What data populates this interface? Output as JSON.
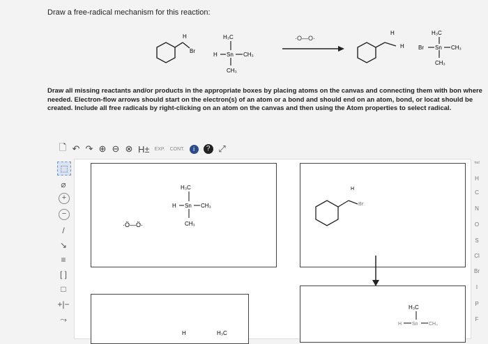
{
  "prompt": "Draw a free-radical mechanism for this reaction:",
  "instructions": "Draw all missing reactants and/or products in the appropriate boxes by placing atoms on the canvas and connecting them with bon where needed. Electron-flow arrows should start on the electron(s) of an atom or a bond and should end on an atom, bond, or locat should be created. Include all free radicals by right-clicking on an atom on the canvas and then using the Atom properties to select radical.",
  "reaction": {
    "reactant_substituent": "Br",
    "reactant_h_top": "H",
    "tin_reagent": {
      "h3c": "H₃C",
      "h": "H",
      "sn": "Sn",
      "ch3_right": "CH₃",
      "ch3_bottom": "CH₃"
    },
    "initiator": "·O—O·",
    "product_h": "H",
    "product_h_top": "H",
    "tin_product": {
      "h3c": "H₃C",
      "br": "Br",
      "sn": "Sn",
      "ch3_right": "CH₃",
      "ch3_bottom": "CH₃"
    }
  },
  "toolbar": {
    "new": "🗋",
    "undo": "↶",
    "redo": "↷",
    "zoom_in": "⊕",
    "zoom_out": "⊖",
    "zoom_reset": "⊗",
    "hydrogen": "H±",
    "exp": "EXP.",
    "cont": "CONT.",
    "info": "i",
    "help": "?",
    "expand": "⤢"
  },
  "left_tools": [
    "⬚",
    "⌀",
    "+",
    "−",
    "/",
    "↘",
    "≡",
    "[ ]",
    "□",
    "+|−",
    "⤳"
  ],
  "elements": [
    "ⁱᵗᵉˡ",
    "H",
    "C",
    "N",
    "O",
    "S",
    "Cl",
    "Br",
    "I",
    "P",
    "F"
  ],
  "canvas": {
    "box1": {
      "tin": {
        "h3c": "H₃C",
        "h": "H",
        "sn": "Sn",
        "ch3_right": "CH₃",
        "ch3_bottom": "CH₃"
      },
      "oxy": "·Ö—Ö·"
    },
    "box2": {
      "h": "H",
      "br": "Br:"
    },
    "box4": {
      "h3c": "H₃C",
      "h": "H",
      "sn": "Sn",
      "ch3": "CH₃"
    },
    "box3": {
      "h": "H",
      "h3c": "H₃C"
    }
  }
}
